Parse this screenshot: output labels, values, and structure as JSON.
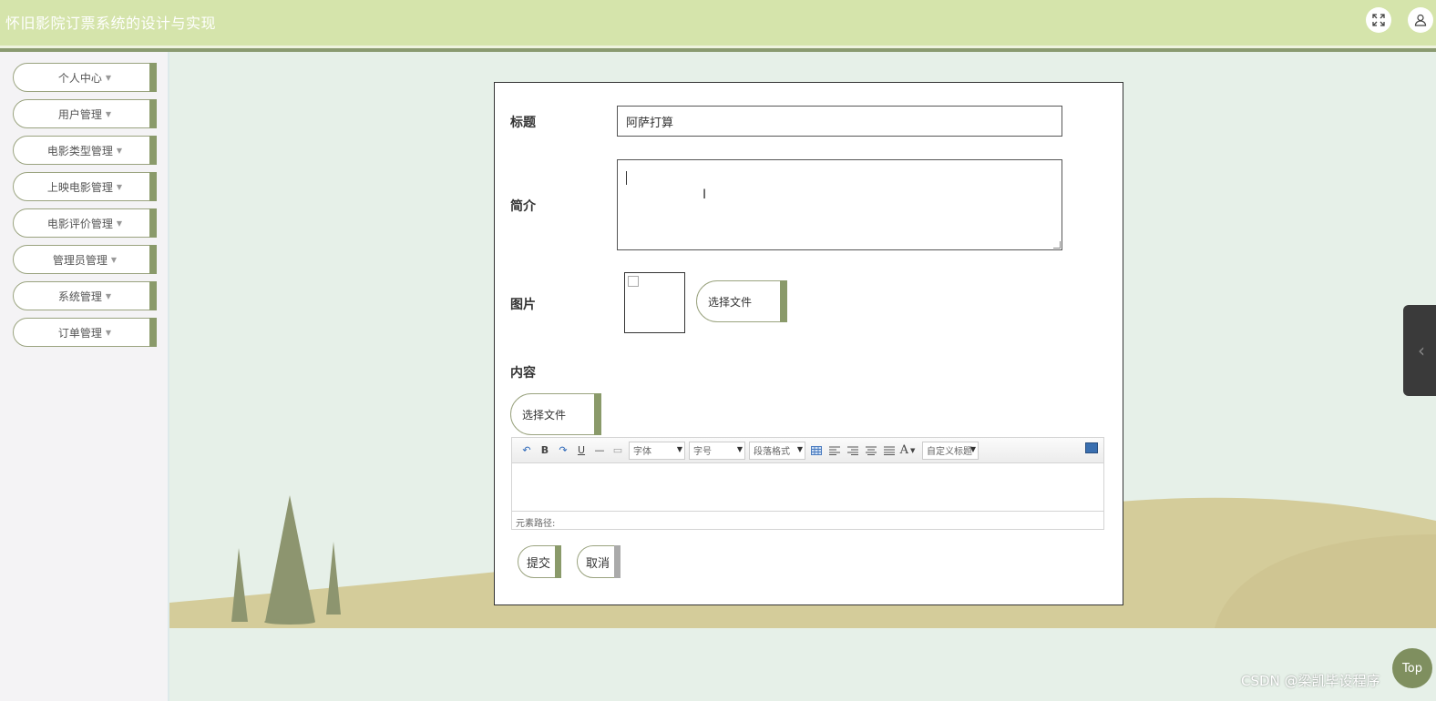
{
  "header": {
    "app_title": "怀旧影院订票系统的设计与实现",
    "fullscreen_icon": "expand-icon",
    "user_icon": "user-icon"
  },
  "sidebar": {
    "items": [
      {
        "label": "个人中心"
      },
      {
        "label": "用户管理"
      },
      {
        "label": "电影类型管理"
      },
      {
        "label": "上映电影管理"
      },
      {
        "label": "电影评价管理"
      },
      {
        "label": "管理员管理"
      },
      {
        "label": "系统管理"
      },
      {
        "label": "订单管理"
      }
    ]
  },
  "form": {
    "title_label": "标题",
    "title_value": "阿萨打算",
    "intro_label": "简介",
    "intro_value": "",
    "image_label": "图片",
    "image_button": "选择文件",
    "content_label": "内容",
    "content_button": "选择文件",
    "submit_label": "提交",
    "cancel_label": "取消"
  },
  "editor": {
    "toolbar": {
      "undo": "↶",
      "bold": "B",
      "redo": "↷",
      "underline": "U",
      "hr": "—",
      "page": "▭",
      "font_family": "字体",
      "font_size": "字号",
      "paragraph": "段落格式",
      "font_color": "A",
      "custom_title": "自定义标题"
    },
    "path_label": "元素路径:"
  },
  "footer": {
    "top_button": "Top",
    "watermark": "CSDN @梁凯毕设程序"
  },
  "colors": {
    "header_bg": "#d5e4ab",
    "accent": "#8a9a6a",
    "page_bg": "#e6f0e8",
    "ground": "#d4cc9a"
  }
}
